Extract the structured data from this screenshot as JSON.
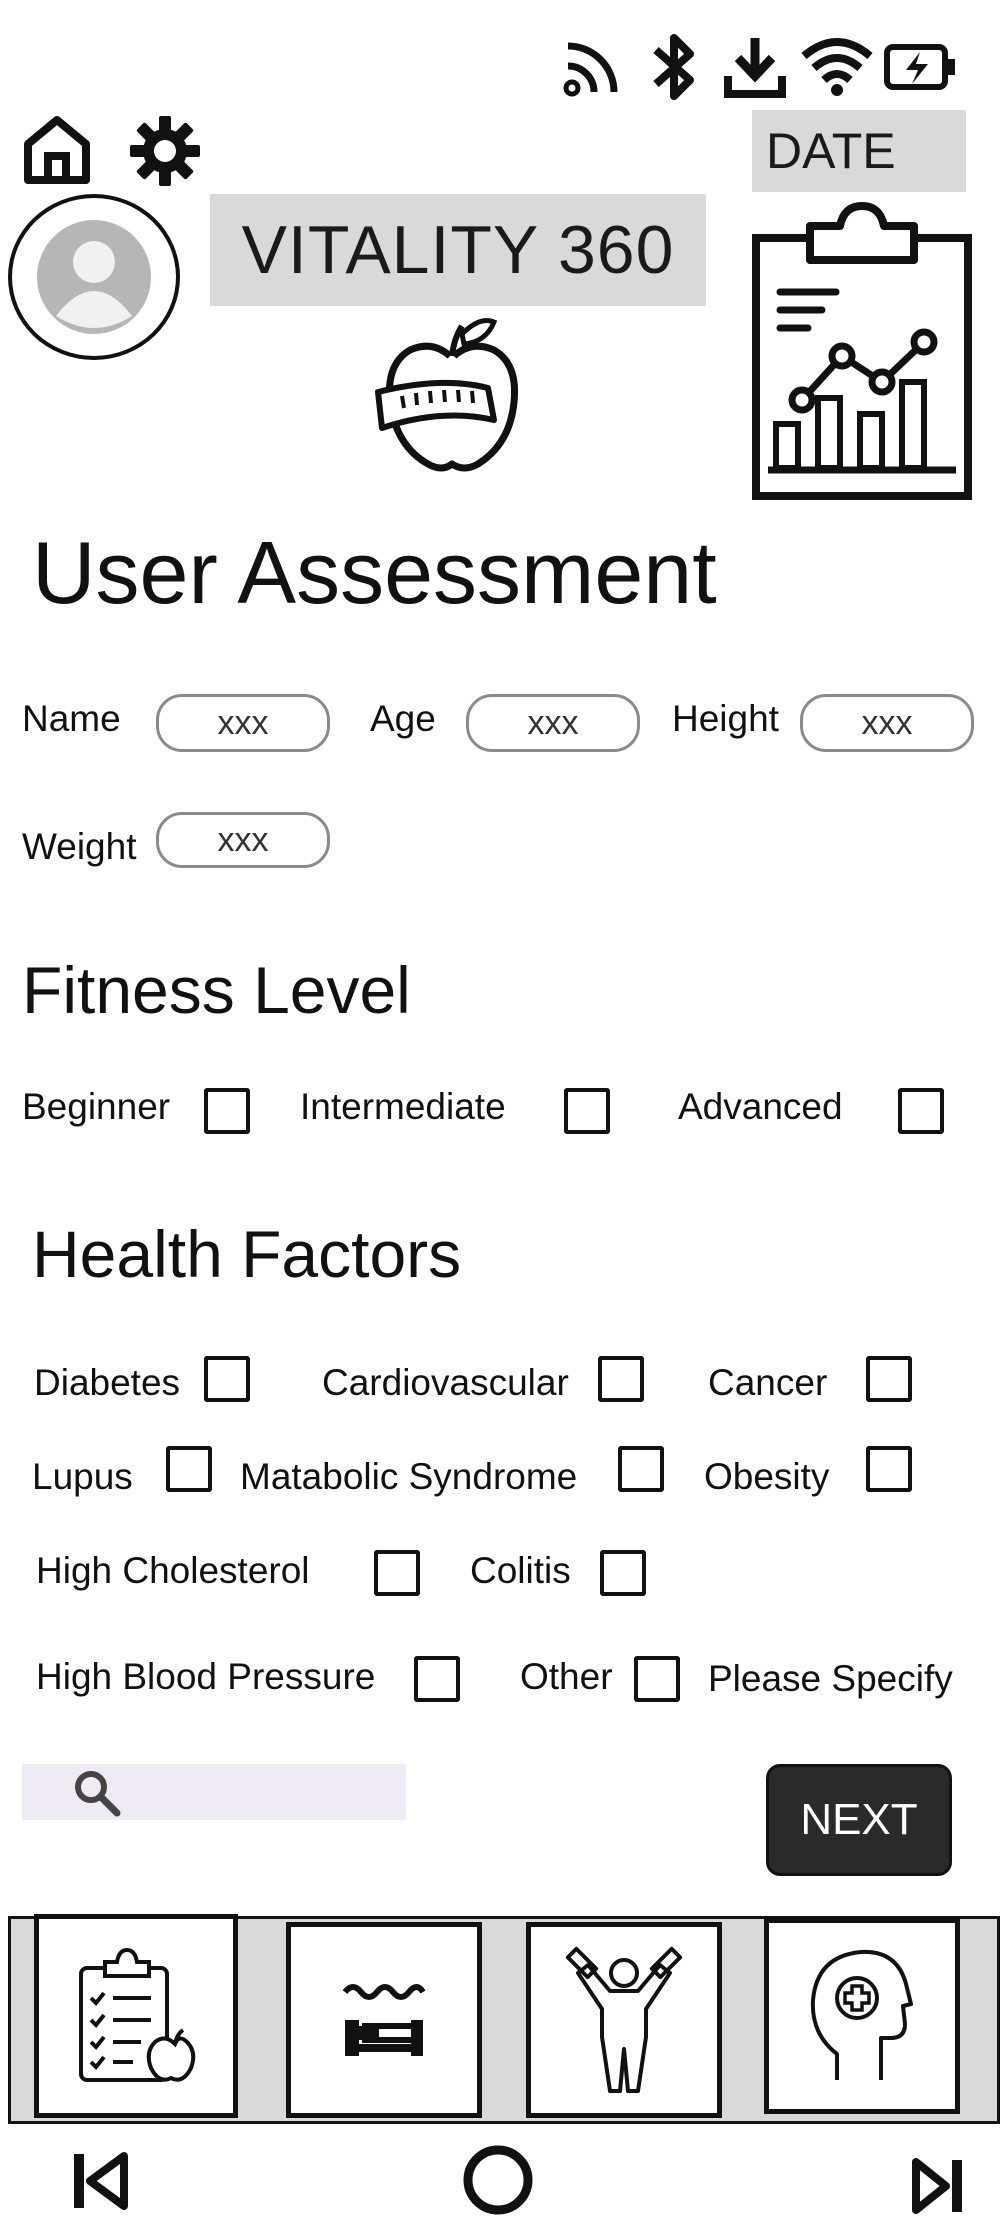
{
  "status_bar": {
    "icons": [
      "cast-icon",
      "bluetooth-icon",
      "download-icon",
      "wifi-icon",
      "battery-charging-icon"
    ]
  },
  "header": {
    "app_title": "VITALITY 360",
    "date_label": "DATE",
    "icons": [
      "home-icon",
      "gear-icon",
      "avatar-icon",
      "apple-tape-logo",
      "clipboard-chart-icon"
    ]
  },
  "assessment": {
    "title": "User Assessment",
    "fields": {
      "name": {
        "label": "Name",
        "value": "xxx"
      },
      "age": {
        "label": "Age",
        "value": "xxx"
      },
      "height": {
        "label": "Height",
        "value": "xxx"
      },
      "weight": {
        "label": "Weight",
        "value": "xxx"
      }
    }
  },
  "fitness": {
    "title": "Fitness Level",
    "options": [
      "Beginner",
      "Intermediate",
      "Advanced"
    ]
  },
  "health": {
    "title": "Health Factors",
    "options": [
      "Diabetes",
      "Cardiovascular",
      "Cancer",
      "Lupus",
      "Matabolic Syndrome",
      "Obesity",
      "High Cholesterol",
      "Colitis",
      "High Blood Pressure",
      "Other"
    ],
    "specify_label": "Please Specify"
  },
  "actions": {
    "next_label": "NEXT",
    "search_icon": "search-icon"
  },
  "bottom_tabs": [
    "assessment-apple-icon",
    "sleep-icon",
    "workout-icon",
    "mental-health-icon"
  ],
  "nav": [
    "previous-icon",
    "home-circle-icon",
    "next-icon"
  ],
  "colors": {
    "gray_box": "#d9d9d9",
    "search_bg": "#efeaf4",
    "button_dark": "#2a2a2a"
  }
}
